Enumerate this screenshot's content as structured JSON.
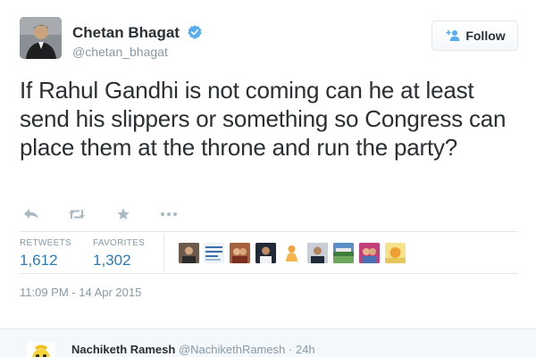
{
  "tweet": {
    "author_name": "Chetan Bhagat",
    "author_handle": "@chetan_bhagat",
    "verified": true,
    "text": "If Rahul Gandhi is not coming can he at least send his slippers or something so Congress can place them at the throne and run the party?",
    "follow_label": "Follow",
    "retweets_label": "RETWEETS",
    "retweets_count": "1,612",
    "favorites_label": "FAVORITES",
    "favorites_count": "1,302",
    "timestamp": "11:09 PM - 14 Apr 2015",
    "actions": [
      "reply-icon",
      "retweet-icon",
      "favorite-icon",
      "more-icon"
    ]
  },
  "reply": {
    "author_name": "Nachiketh Ramesh",
    "author_handle": "@NachikethRamesh",
    "separator": "·",
    "time": "24h"
  },
  "colors": {
    "accent": "#2b7bb9",
    "verified": "#55acee",
    "muted": "#8899a6",
    "text": "#292f33"
  }
}
